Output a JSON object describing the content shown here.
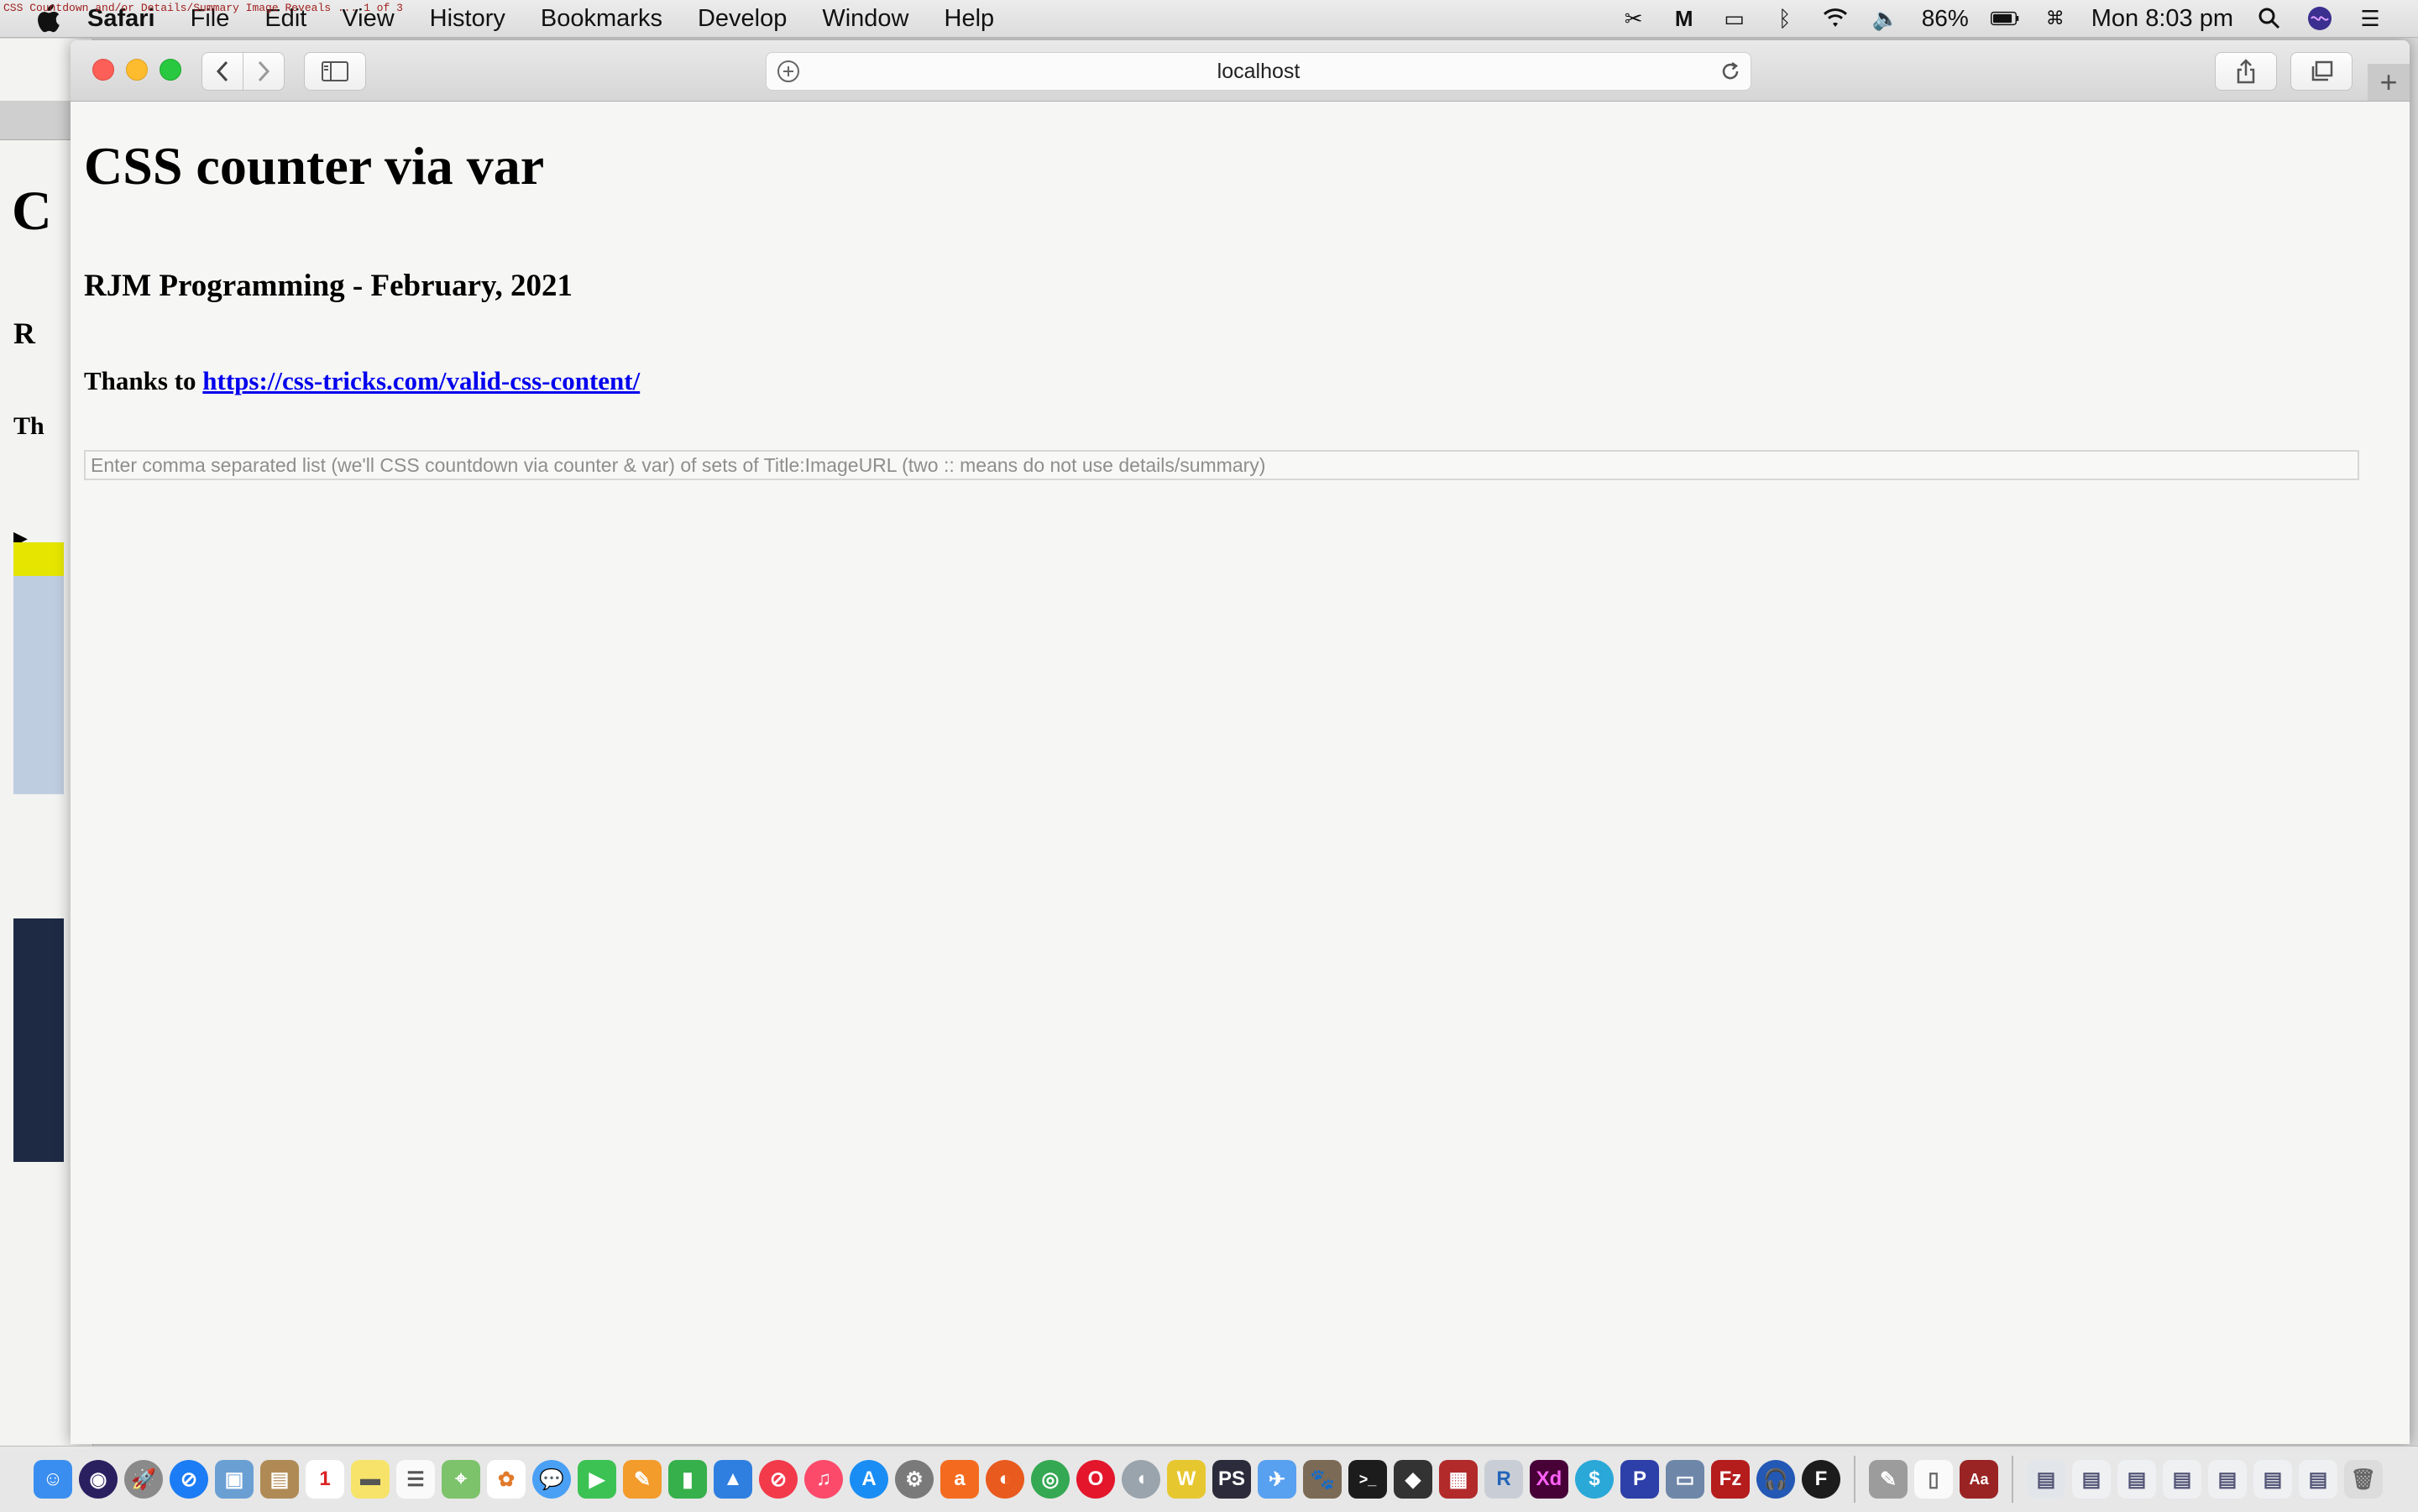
{
  "menubar": {
    "apple_icon": "apple-icon",
    "app_name": "Safari",
    "items": [
      "File",
      "Edit",
      "View",
      "History",
      "Bookmarks",
      "Develop",
      "Window",
      "Help"
    ],
    "battery": "86%",
    "clock": "Mon 8:03 pm"
  },
  "background_window": {
    "tab_title": "CSS Countdown and/or Details/Summary Image Reveals ... 1 of 3",
    "heading_initial": "C",
    "sub_initial": "R",
    "thanks_initial": "Th"
  },
  "browser": {
    "url": "localhost"
  },
  "page": {
    "title": "CSS counter via var",
    "subtitle": "RJM Programming - February, 2021",
    "thanks_prefix": "Thanks to ",
    "thanks_link": "https://css-tricks.com/valid-css-content/",
    "input_placeholder": "Enter comma separated list (we'll CSS countdown via counter & var) of sets of Title:ImageURL (two :: means do not use details/summary)",
    "input_value": ""
  },
  "colors": {
    "link": "#0000ee",
    "close": "#fc5f57",
    "minimize": "#fdbc2e",
    "maximize": "#28c840"
  }
}
